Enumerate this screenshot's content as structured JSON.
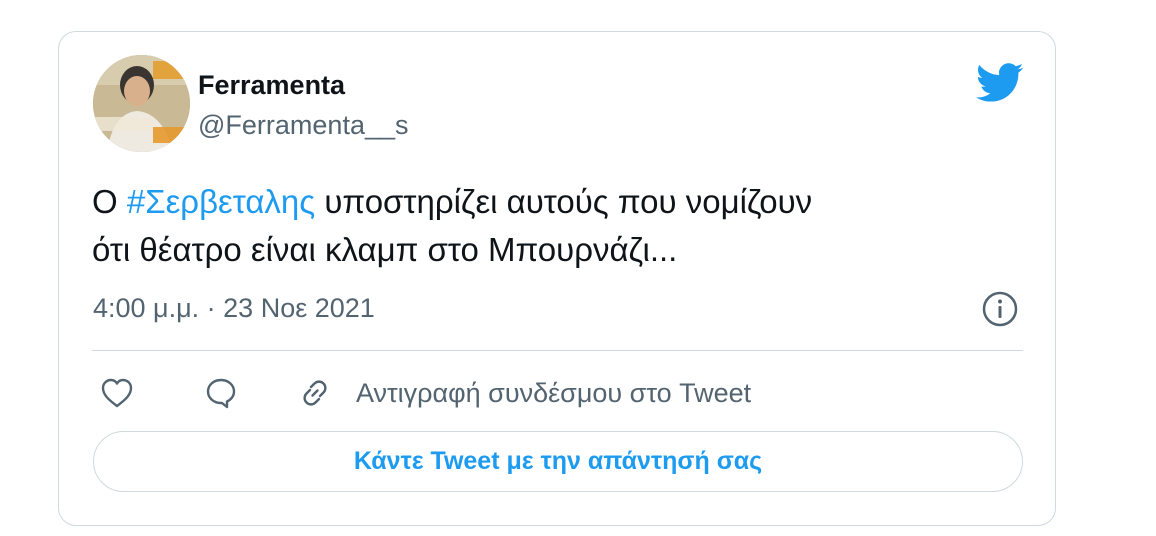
{
  "tweet": {
    "author": {
      "name": "Ferramenta",
      "handle": "@Ferramenta__s"
    },
    "text": {
      "prefix": "Ο ",
      "hashtag": "#Σερβεταλης",
      "line1_rest": " υποστηρίζει αυτούς που νομίζουν",
      "line2": "ότι θέατρο είναι κλαμπ στο Μπουρνάζι..."
    },
    "timestamp": "4:00 μ.μ. · 23 Νοε 2021"
  },
  "actions": {
    "copy_link_label": "Αντιγραφή συνδέσμου στο Tweet"
  },
  "reply_cta": {
    "label": "Κάντε Tweet με την απάντησή σας"
  },
  "icons": {
    "brand": "twitter-bird-icon",
    "info": "info-icon",
    "like": "heart-icon",
    "reply": "reply-bubble-icon",
    "link": "link-icon"
  },
  "colors": {
    "accent": "#1d9bf0",
    "text_primary": "#0f1419",
    "text_secondary": "#536471",
    "border": "#cfd9de"
  }
}
